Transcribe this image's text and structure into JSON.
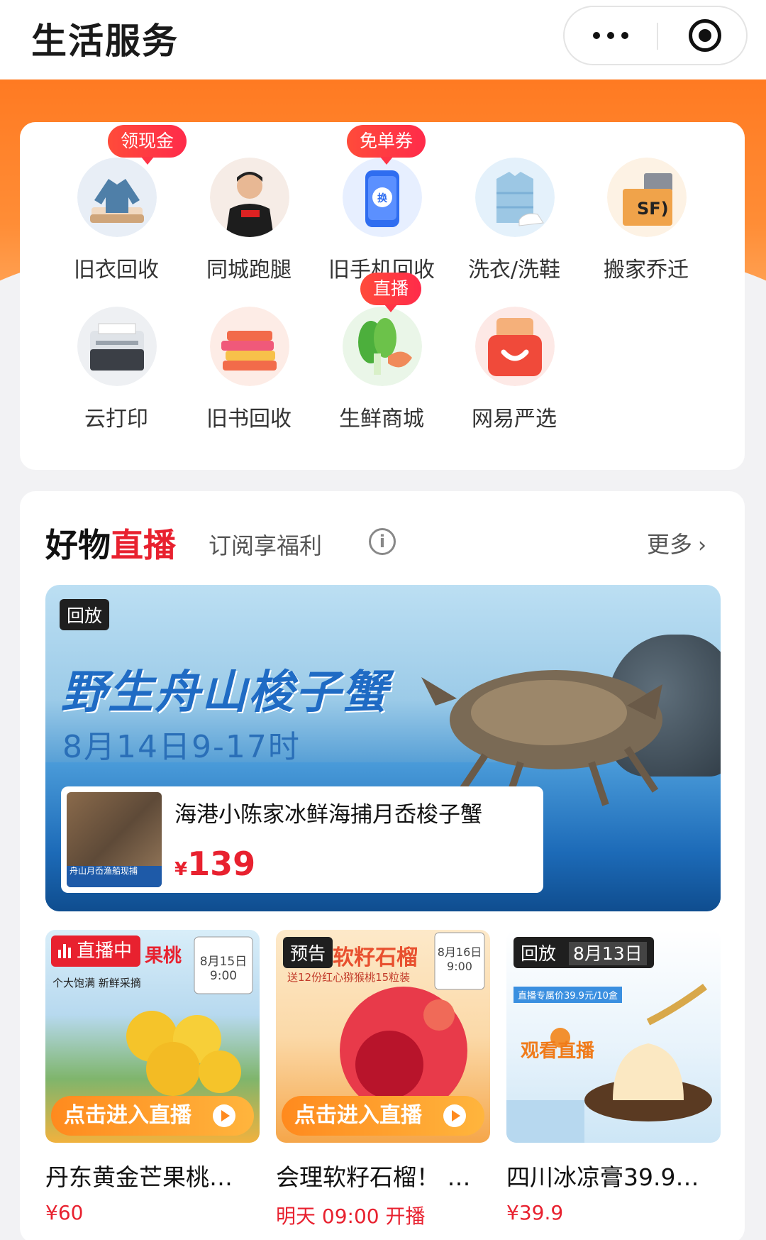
{
  "header": {
    "title": "生活服务"
  },
  "services": [
    {
      "label": "旧衣回收",
      "icon": "clothes-icon",
      "tag": "领现金"
    },
    {
      "label": "同城跑腿",
      "icon": "courier-icon",
      "tag": ""
    },
    {
      "label": "旧手机回收",
      "icon": "phone-icon",
      "tag": "免单券"
    },
    {
      "label": "洗衣/洗鞋",
      "icon": "laundry-icon",
      "tag": ""
    },
    {
      "label": "搬家乔迁",
      "icon": "moving-box-icon",
      "tag": ""
    },
    {
      "label": "云打印",
      "icon": "printer-icon",
      "tag": ""
    },
    {
      "label": "旧书回收",
      "icon": "books-icon",
      "tag": ""
    },
    {
      "label": "生鲜商城",
      "icon": "vegetable-fish-icon",
      "tag": "直播"
    },
    {
      "label": "网易严选",
      "icon": "shopping-bag-icon",
      "tag": ""
    }
  ],
  "live": {
    "title_black": "好物",
    "title_red": "直播",
    "subtitle": "订阅享福利",
    "info": "i",
    "more": "更多",
    "banner": {
      "badge": "回放",
      "headline": "野生舟山梭子蟹",
      "time": "8月14日9-17时",
      "product_name": "海港小陈家冰鲜海捕月岙梭子蟹",
      "currency": "¥",
      "price": "139",
      "thumb_caption": "舟山月岙渔船现捕"
    },
    "cards": [
      {
        "badge": "直播中",
        "poster_title": "果桃",
        "cta": "点击进入直播",
        "name": "丹东黄金芒果桃…",
        "price": "¥60",
        "poster_sub": "个大饱满 新鲜采摘",
        "date_badge": "8月15日 9:00"
      },
      {
        "badge": "预告",
        "poster_title": "软籽石榴",
        "cta": "点击进入直播",
        "name": "会理软籽石榴！ …",
        "price": "明天 09:00 开播",
        "poster_sub": "送12份红心猕猴桃15粒装",
        "date_badge": "8月16日 9:00"
      },
      {
        "badge": "回放",
        "badge_date": "8月13日",
        "poster_title": "观看直播",
        "cta": "",
        "name": "四川冰凉膏39.9…",
        "price": "¥39.9",
        "poster_sub": "直播专属价39.9元/10盒"
      }
    ]
  },
  "colors": {
    "accent_orange": "#ff7a22",
    "accent_red": "#e8212f"
  }
}
